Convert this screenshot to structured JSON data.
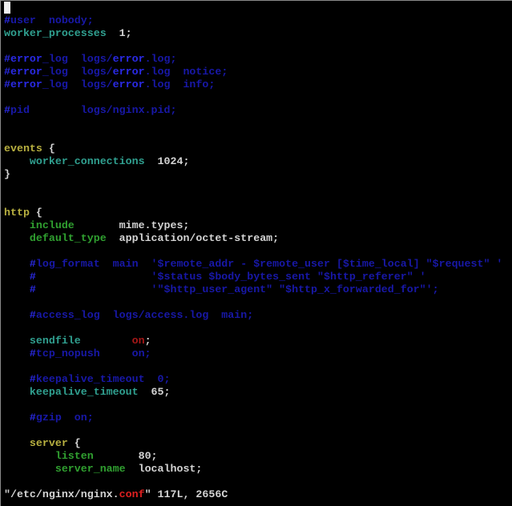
{
  "editor": {
    "lines": [
      [],
      [
        [
          "#",
          "cb"
        ],
        [
          "user  nobody;",
          "c"
        ]
      ],
      [
        [
          "worker_processes",
          "k"
        ],
        [
          "  1;",
          "n"
        ]
      ],
      [],
      [
        [
          "#",
          "cb"
        ],
        [
          "error",
          "cb"
        ],
        [
          "_log  logs/",
          "c"
        ],
        [
          "error",
          "cb"
        ],
        [
          ".log;",
          "c"
        ]
      ],
      [
        [
          "#",
          "cb"
        ],
        [
          "error",
          "cb"
        ],
        [
          "_log  logs/",
          "c"
        ],
        [
          "error",
          "cb"
        ],
        [
          ".log  notice;",
          "c"
        ]
      ],
      [
        [
          "#",
          "cb"
        ],
        [
          "error",
          "cb"
        ],
        [
          "_log  logs/",
          "c"
        ],
        [
          "error",
          "cb"
        ],
        [
          ".log  info;",
          "c"
        ]
      ],
      [],
      [
        [
          "#",
          "cb"
        ],
        [
          "pid        logs/nginx.pid;",
          "c"
        ]
      ],
      [],
      [],
      [
        [
          "events",
          "y"
        ],
        [
          " {",
          "n"
        ]
      ],
      [
        [
          "    ",
          "n"
        ],
        [
          "worker_connections",
          "k"
        ],
        [
          "  1024;",
          "n"
        ]
      ],
      [
        [
          "}",
          "n"
        ]
      ],
      [],
      [],
      [
        [
          "http",
          "y"
        ],
        [
          " {",
          "n"
        ]
      ],
      [
        [
          "    ",
          "n"
        ],
        [
          "include",
          "g"
        ],
        [
          "       mime.types;",
          "n"
        ]
      ],
      [
        [
          "    ",
          "n"
        ],
        [
          "default_type",
          "g"
        ],
        [
          "  application/octet-stream;",
          "n"
        ]
      ],
      [],
      [
        [
          "    ",
          "n"
        ],
        [
          "#",
          "cb"
        ],
        [
          "log_format  main  '$remote_addr - $remote_user [$time_local] \"$request\" '",
          "c"
        ]
      ],
      [
        [
          "    ",
          "n"
        ],
        [
          "#",
          "cb"
        ],
        [
          "                  '$status $body_bytes_sent \"$http_referer\" '",
          "c"
        ]
      ],
      [
        [
          "    ",
          "n"
        ],
        [
          "#",
          "cb"
        ],
        [
          "                  '\"$http_user_agent\" \"$http_x_forwarded_for\"';",
          "c"
        ]
      ],
      [],
      [
        [
          "    ",
          "n"
        ],
        [
          "#",
          "cb"
        ],
        [
          "access_log  logs/access.log  main;",
          "c"
        ]
      ],
      [],
      [
        [
          "    ",
          "n"
        ],
        [
          "sendfile",
          "k"
        ],
        [
          "        ",
          "n"
        ],
        [
          "on",
          "r"
        ],
        [
          ";",
          "n"
        ]
      ],
      [
        [
          "    ",
          "n"
        ],
        [
          "#",
          "cb"
        ],
        [
          "tcp_nopush     on;",
          "c"
        ]
      ],
      [],
      [
        [
          "    ",
          "n"
        ],
        [
          "#",
          "cb"
        ],
        [
          "keepalive_timeout  0;",
          "c"
        ]
      ],
      [
        [
          "    ",
          "n"
        ],
        [
          "keepalive_timeout",
          "k"
        ],
        [
          "  65;",
          "n"
        ]
      ],
      [],
      [
        [
          "    ",
          "n"
        ],
        [
          "#",
          "cb"
        ],
        [
          "gzip  on;",
          "c"
        ]
      ],
      [],
      [
        [
          "    ",
          "n"
        ],
        [
          "server",
          "y"
        ],
        [
          " {",
          "n"
        ]
      ],
      [
        [
          "        ",
          "n"
        ],
        [
          "listen",
          "g"
        ],
        [
          "       80;",
          "n"
        ]
      ],
      [
        [
          "        ",
          "n"
        ],
        [
          "server_name",
          "g"
        ],
        [
          "  localhost;",
          "n"
        ]
      ],
      []
    ],
    "status_line": [
      [
        "\"/etc/nginx/nginx.",
        "n"
      ],
      [
        "conf",
        "rs"
      ],
      [
        "\" 117L, 2656C",
        "n"
      ]
    ]
  }
}
